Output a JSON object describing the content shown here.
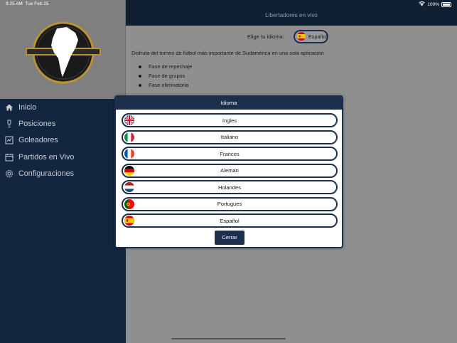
{
  "status": {
    "time": "9:25 AM",
    "date": "Tue Feb 25",
    "battery": "100%"
  },
  "sidebar": {
    "items": [
      {
        "label": "Inicio",
        "icon": "home-icon"
      },
      {
        "label": "Posiciones",
        "icon": "trophy-icon"
      },
      {
        "label": "Goleadores",
        "icon": "tactics-icon"
      },
      {
        "label": "Partidos en Vivo",
        "icon": "calendar-icon"
      },
      {
        "label": "Configuraciones",
        "icon": "gear-icon"
      }
    ]
  },
  "header": {
    "title": "Libertadores en vivo"
  },
  "language": {
    "label": "Elige tu idioma:",
    "selected": "Español"
  },
  "content": {
    "description": "Disfruta del torneo de fútbol más importante de Sudamérica en una sola aplicación",
    "bullets": [
      "Fase de repechaje",
      "Fase de grupos",
      "Fase eliminatoria"
    ]
  },
  "modal": {
    "title": "Idioma",
    "options": [
      {
        "label": "Ingles",
        "flag": "uk"
      },
      {
        "label": "Italiano",
        "flag": "it"
      },
      {
        "label": "Frances",
        "flag": "fr"
      },
      {
        "label": "Aleman",
        "flag": "de"
      },
      {
        "label": "Holandes",
        "flag": "nl"
      },
      {
        "label": "Portugues",
        "flag": "pt"
      },
      {
        "label": "Español",
        "flag": "es"
      }
    ],
    "close_label": "Cerrar"
  },
  "colors": {
    "navy": "#1c2f4c",
    "sidebar": "#132640",
    "gold": "#b8932f"
  }
}
